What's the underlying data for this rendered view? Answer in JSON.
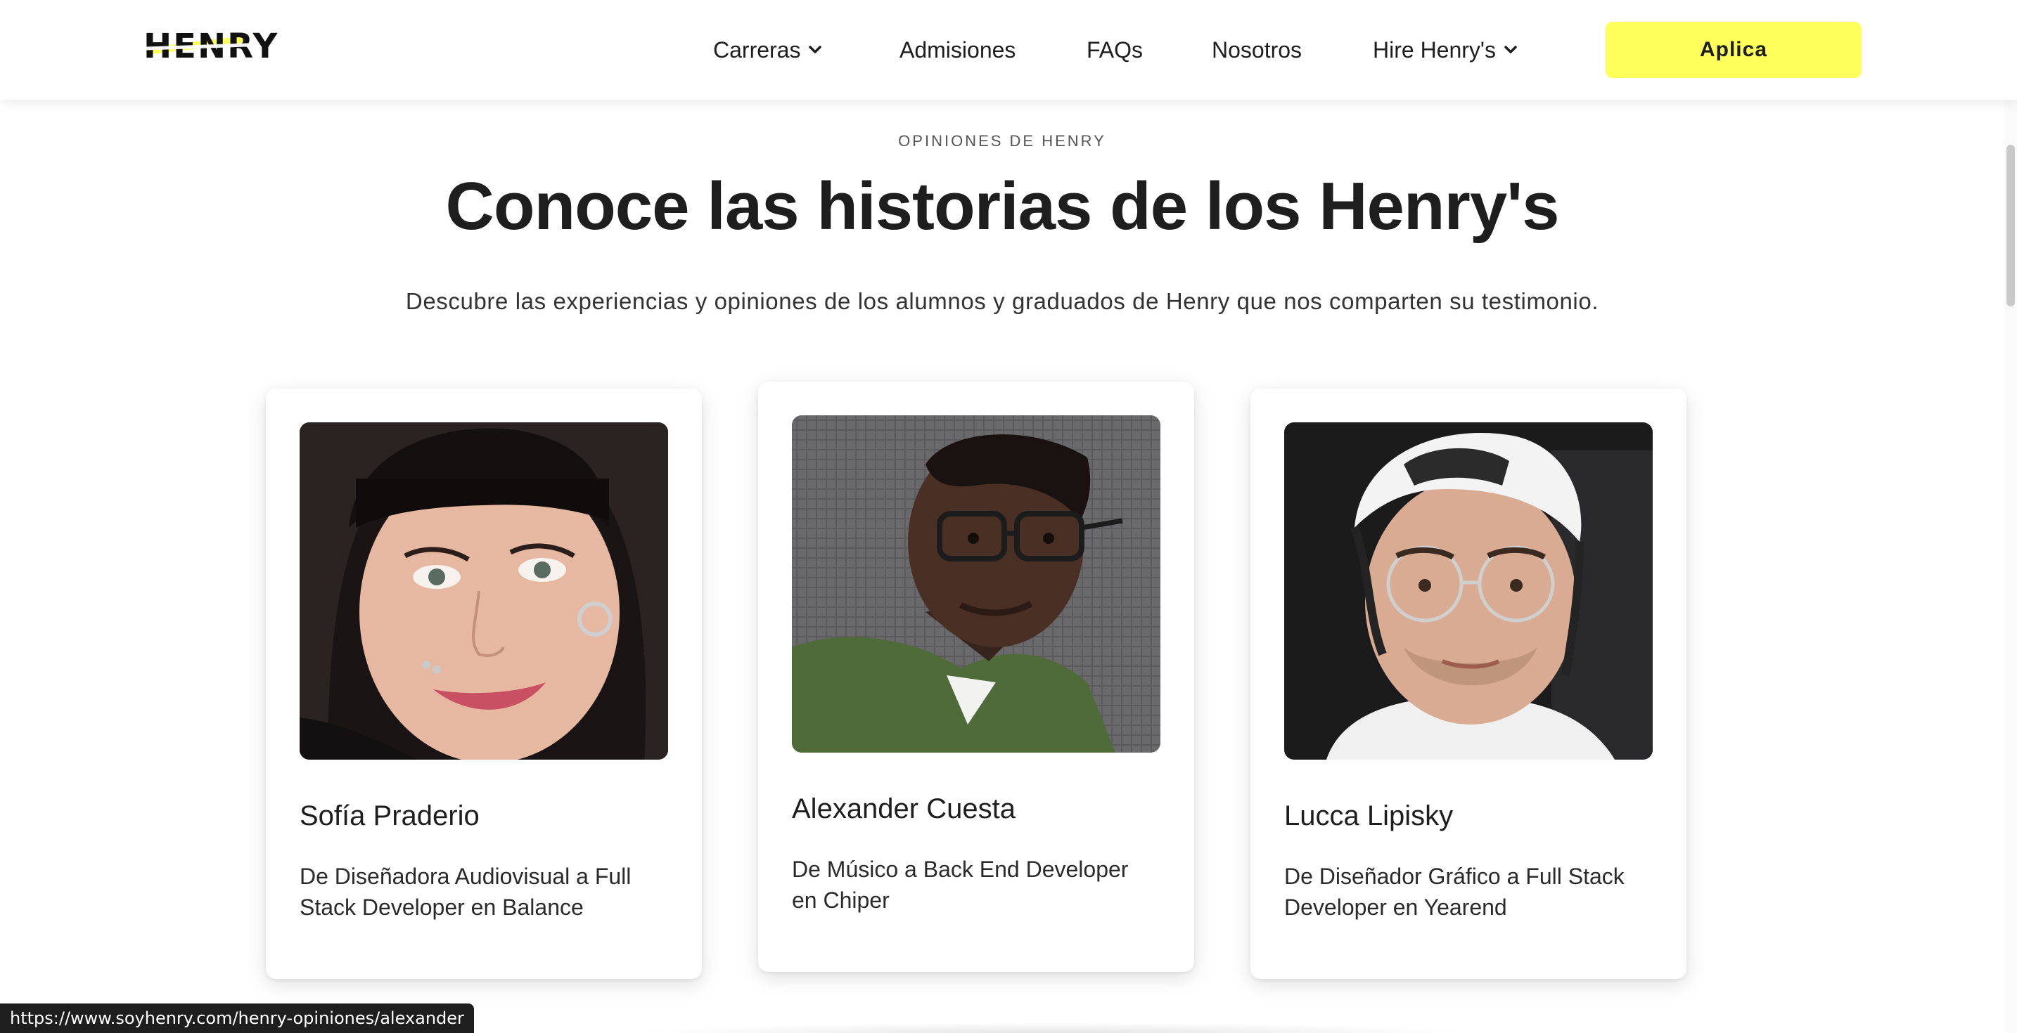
{
  "brand": {
    "logo_text": "HENRY",
    "accent_color": "#ffff5c"
  },
  "nav": {
    "items": [
      {
        "label": "Carreras",
        "has_dropdown": true
      },
      {
        "label": "Admisiones",
        "has_dropdown": false
      },
      {
        "label": "FAQs",
        "has_dropdown": false
      },
      {
        "label": "Nosotros",
        "has_dropdown": false
      },
      {
        "label": "Hire Henry's",
        "has_dropdown": true
      }
    ],
    "cta_label": "Aplica"
  },
  "hero": {
    "eyebrow": "OPINIONES DE HENRY",
    "title": "Conoce las historias de los Henry's",
    "subtitle": "Descubre las experiencias y opiniones de los alumnos y graduados de Henry que nos comparten su testimonio."
  },
  "testimonials": [
    {
      "name": "Sofía Praderio",
      "description": "De Diseñadora Audiovisual a Full Stack Developer en Balance"
    },
    {
      "name": "Alexander Cuesta",
      "description": "De Músico a Back End Developer en Chiper"
    },
    {
      "name": "Lucca Lipisky",
      "description": "De Diseñador Gráfico a Full Stack Developer en Yearend"
    }
  ],
  "status_bar": {
    "url": "https://www.soyhenry.com/henry-opiniones/alexander"
  }
}
